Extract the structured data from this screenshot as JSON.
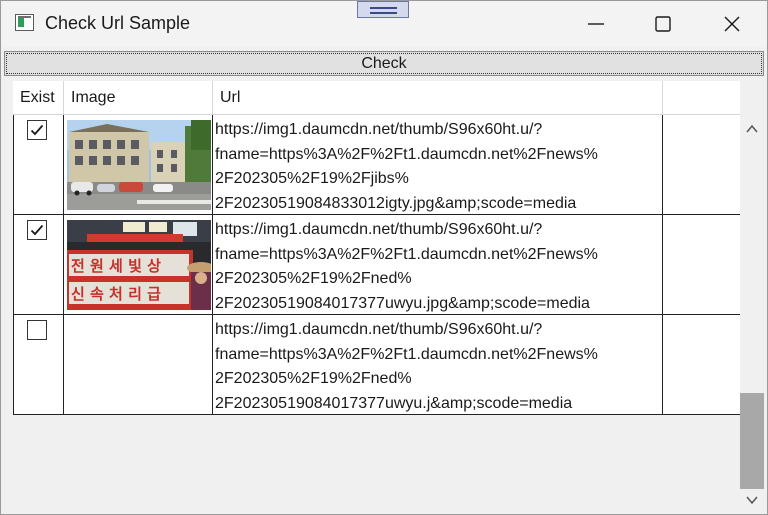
{
  "window": {
    "title": "Check Url Sample"
  },
  "toolbar": {
    "check_label": "Check"
  },
  "grid": {
    "columns": [
      "Exist",
      "Image",
      "Url"
    ],
    "rows": [
      {
        "exist": true,
        "image": "street-buildings-photo",
        "url": "https://img1.daumcdn.net/thumb/S96x60ht.u/?\nfname=https%3A%2F%2Ft1.daumcdn.net%2Fnews%\n2F202305%2F19%2Fjibs%\n2F20230519084833012igty.jpg&amp;scode=media"
      },
      {
        "exist": true,
        "image": "korean-sign-photo",
        "url": "https://img1.daumcdn.net/thumb/S96x60ht.u/?\nfname=https%3A%2F%2Ft1.daumcdn.net%2Fnews%\n2F202305%2F19%2Fned%\n2F20230519084017377uwyu.jpg&amp;scode=media"
      },
      {
        "exist": false,
        "image": "",
        "url": "https://img1.daumcdn.net/thumb/S96x60ht.u/?\nfname=https%3A%2F%2Ft1.daumcdn.net%2Fnews%\n2F202305%2F19%2Fned%\n2F20230519084017377uwyu.j&amp;scode=media"
      }
    ],
    "sign_text": {
      "top": "전 원 세 빛 상",
      "bottom": "신 속 처 리 급"
    }
  }
}
